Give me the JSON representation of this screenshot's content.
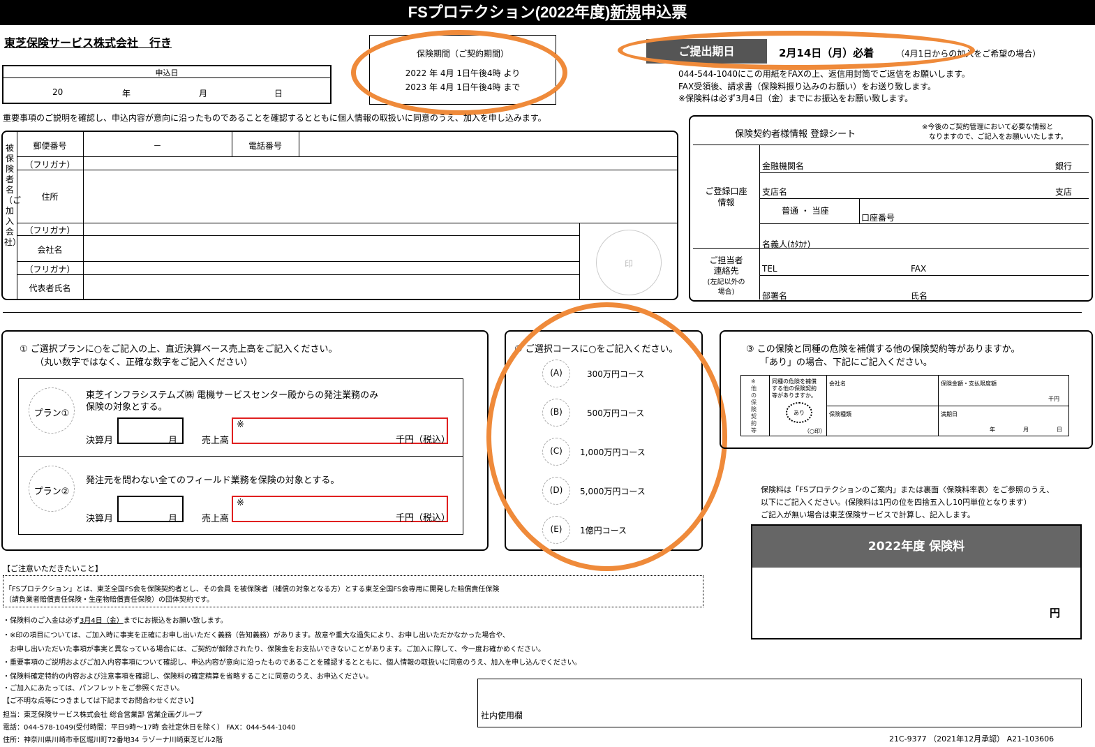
{
  "title": {
    "prefix": "FSプロテクション(2022年度)",
    "new": "新規",
    "suffix": "申込票"
  },
  "addressee": "東芝保険サービス株式会社　行き",
  "application_date": {
    "label": "申込日",
    "year_prefix": "20",
    "year": "年",
    "month": "月",
    "day": "日"
  },
  "period": {
    "label": "保険期間（ご契約期間）",
    "from": "2022 年 4月 1日午後4時 より",
    "to": "2023 年 4月 1日午後4時 まで"
  },
  "deadline": {
    "label": "ご提出期日",
    "date": "2月14日（月）必着",
    "note": "（4月1日からの加入をご希望の場合）"
  },
  "instructions": [
    "044-544-1040にこの用紙をFAXの上、返信用封筒でご返信をお願いします。",
    "FAX受領後、請求書（保険料振り込みのお願い）をお送り致します。",
    "※保険料は必ず3月4日（金）までにお振込をお願い致します。"
  ],
  "consent": "重要事項のご説明を確認し、申込内容が意向に沿ったものであることを確認するとともに個人情報の取扱いに同意のうえ、加入を申し込みます。",
  "insured": {
    "side_label": "被保険者名（ご加入会社）",
    "postal_label": "郵便番号",
    "postal_dash": "－",
    "phone_label": "電話番号",
    "furigana": "（フリガナ）",
    "address_label": "住所",
    "company_label": "会社名",
    "rep_label": "代表者氏名",
    "seal": "印"
  },
  "registration": {
    "title": "保険契約者様情報 登録シート",
    "note1": "※今後のご契約管理において必要な情報と",
    "note2": "なりますので、ご記入をお願いいたします。",
    "account_label1": "ご登録口座",
    "account_label2": "情報",
    "bank_label": "金融機関名",
    "bank_suffix": "銀行",
    "branch_label": "支店名",
    "branch_suffix": "支店",
    "type": "普通 ・ 当座",
    "account_no": "口座番号",
    "holder": "名義人(ｶﾀｶﾅ)",
    "contact_label1": "ご担当者",
    "contact_label2": "連絡先",
    "contact_label3": "(左記以外の",
    "contact_label4": "場合)",
    "tel": "TEL",
    "fax": "FAX",
    "dept": "部署名",
    "name": "氏名"
  },
  "plan": {
    "heading1": "①  ご選択プランに○をご記入の上、直近決算ベース売上高をご記入ください。",
    "heading2": "（丸い数字ではなく、正確な数字をご記入ください）",
    "plan1_label": "プラン①",
    "plan1_text1": "東芝インフラシステムズ㈱  電機サービスセンター殿からの発注業務のみ",
    "plan1_text2": "保険の対象とする。",
    "plan2_label": "プラン②",
    "plan2_text": "発注元を問わない全てのフィールド業務を保険の対象とする。",
    "fiscal_month": "決算月",
    "month": "月",
    "sales": "売上高",
    "mark": "※",
    "unit": "千円（税込）"
  },
  "course": {
    "heading": "②  ご選択コースに○をご記入ください。",
    "items": [
      {
        "code": "(A)",
        "label": "300万円コース"
      },
      {
        "code": "(B)",
        "label": "500万円コース"
      },
      {
        "code": "(C)",
        "label": "1,000万円コース"
      },
      {
        "code": "(D)",
        "label": "5,000万円コース"
      },
      {
        "code": "(E)",
        "label": "1億円コース"
      }
    ]
  },
  "other": {
    "heading1": "③  この保険と同種の危険を補償する他の保険契約等がありますか。",
    "heading2": "「あり」の場合、下記にご記入ください。",
    "side": "※他の保険契約等",
    "q1": "同種の危険を補償",
    "q2": "する他の保険契約",
    "q3": "等がありますか。",
    "ari": "あり",
    "circle_note": "（○印）",
    "company": "会社名",
    "amount": "保険金額・支払限度額",
    "thousand_yen": "千円",
    "type": "保険種類",
    "expiry": "満期日",
    "year": "年",
    "month": "月",
    "day": "日"
  },
  "premium": {
    "note1": "保険料は「FSプロテクションのご案内」または裏面〈保険料率表〉をご参照のうえ、",
    "note2": "以下にご記入ください。(保険料は1円の位を四捨五入し10円単位となります）",
    "note3": "ご記入が無い場合は東芝保険サービスで計算し、記入します。",
    "header": "2022年度 保険料",
    "unit": "円"
  },
  "caution": {
    "heading": "【ご注意いただきたいこと】",
    "box1": "「FSプロテクション」とは、東芝全国FS会を保険契約者とし、その会員 を被保険者（補償の対象となる方）とする東芝全国FS会専用に開発した賠償責任保険",
    "box2": "（請負業者賠償責任保険・生産物賠償責任保険）の団体契約です。",
    "line1a": "・保険料のご入金は必ず",
    "line1b": "3月4日（金）",
    "line1c": "までにお振込をお願い致します。",
    "line2": "・※印の項目については、ご加入時に事実を正確にお申し出いただく義務（告知義務）があります。故意や重大な過失により、お申し出いただかなかった場合や、",
    "line3": "　お申し出いただいた事項が事実と異なっている場合には、ご契約が解除されたり、保険金をお支払いできないことがあります。ご加入に際して、今一度お確かめください。",
    "line4": "・重要事項のご説明およびご加入内容事項について確認し、申込内容が意向に沿ったものであることを確認するとともに、個人情報の取扱いに同意のうえ、加入を申し込んでください。",
    "line5": "・保険料確定特約の内容および注意事項を確認し、保険料の確定精算を省略することに同意のうえ、お申込ください。",
    "line6": "・ご加入にあたっては、パンフレットをご参照ください。"
  },
  "contact": {
    "heading": "【ご不明な点等につきましては下記までお問合わせください】",
    "person": "担当：東芝保険サービス株式会社  総合営業部 営業企画グループ",
    "phone": "電話：044-578-1049(受付時間：平日9時～17時  会社定休日を除く）  FAX：044-544-1040",
    "address": "住所：神奈川県川崎市幸区堀川町72番地34  ラゾーナ川崎東芝ビル2階"
  },
  "internal": "社内使用欄",
  "footer_code": "21C-9377  （2021年12月承認）  A21-103606",
  "colors": {
    "highlight": "#ef8a3a",
    "deadline_bg": "#555555",
    "premium_bg": "#666666",
    "warning": "#e02020"
  }
}
